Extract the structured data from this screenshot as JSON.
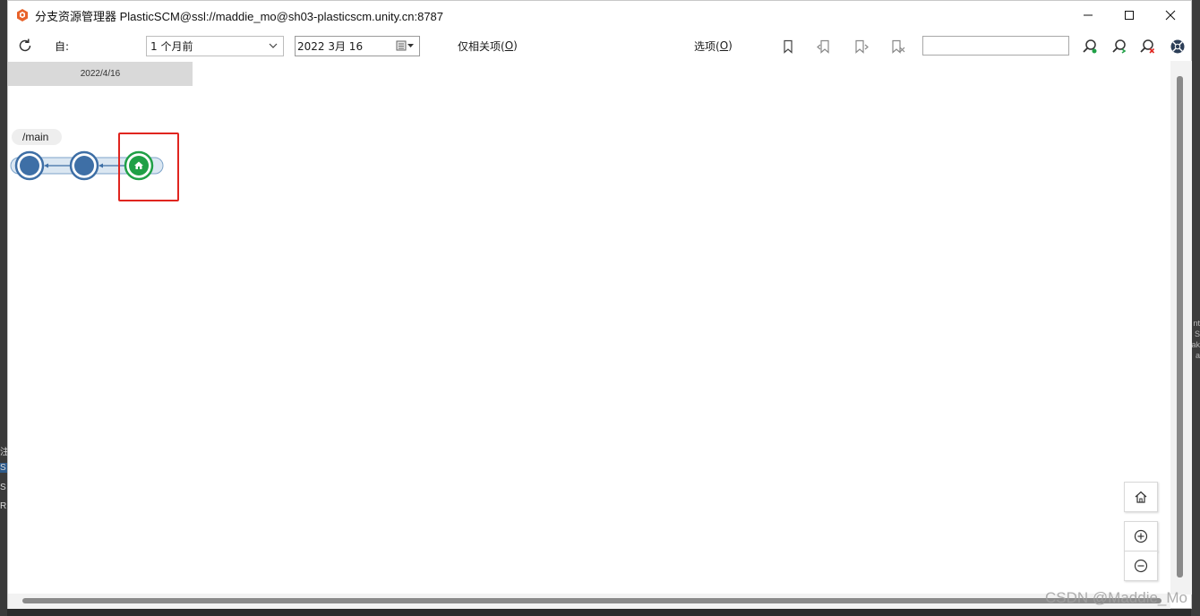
{
  "window": {
    "title": "分支资源管理器 PlasticSCM@ssl://maddie_mo@sh03-plasticscm.unity.cn:8787",
    "controls": {
      "minimize": "minimize-icon",
      "maximize": "maximize-icon",
      "close": "close-icon"
    }
  },
  "toolbar": {
    "refresh_icon": "refresh-icon",
    "from_label": "自:",
    "period_value": "1 个月前",
    "date_value": "2022  3月  16",
    "only_related_prefix": "仅相关项(",
    "only_related_key": "O",
    "only_related_suffix": ")",
    "options_prefix": "选项(",
    "options_key": "O",
    "options_suffix": ")",
    "search_value": "",
    "icons": [
      "bookmark-icon",
      "bookmark-back-icon",
      "bookmark-forward-icon",
      "bookmark-clear-icon",
      "search-icon",
      "search-next-icon",
      "search-clear-icon",
      "help-icon"
    ]
  },
  "canvas": {
    "date_header": "2022/4/16",
    "branch_name": "/main",
    "changesets": [
      {
        "kind": "changeset",
        "color": "#3e6fa6"
      },
      {
        "kind": "changeset",
        "color": "#3e6fa6"
      },
      {
        "kind": "home-changeset",
        "color": "#1fa046"
      }
    ],
    "highlight_color": "#e0251f"
  },
  "zoom": {
    "home": "home-icon",
    "zoom_in": "zoom-in-icon",
    "zoom_out": "zoom-out-icon"
  },
  "background": {
    "left_fragments": [
      "注",
      "S",
      "S",
      "R"
    ],
    "right_fragments": [
      "nt",
      "S",
      "ak",
      "a"
    ]
  },
  "watermark": "CSDN @Maddie_Mo"
}
